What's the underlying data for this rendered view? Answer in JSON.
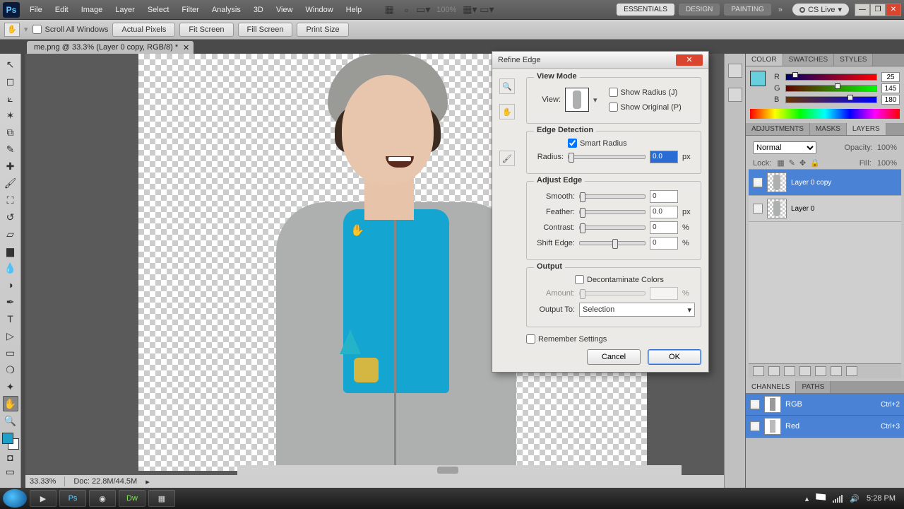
{
  "menu": {
    "items": [
      "File",
      "Edit",
      "Image",
      "Layer",
      "Select",
      "Filter",
      "Analysis",
      "3D",
      "View",
      "Window",
      "Help"
    ]
  },
  "workspace": {
    "essentials": "ESSENTIALS",
    "design": "DESIGN",
    "painting": "PAINTING",
    "cslive": "CS Live",
    "zoom": "100%"
  },
  "options": {
    "scroll_all": "Scroll All Windows",
    "actual": "Actual Pixels",
    "fit": "Fit Screen",
    "fill": "Fill Screen",
    "print": "Print Size"
  },
  "doc": {
    "tab": "me.png @ 33.3% (Layer 0 copy, RGB/8) *",
    "zoom": "33.33%",
    "docsize": "Doc: 22.8M/44.5M"
  },
  "color": {
    "tabs": {
      "color": "COLOR",
      "swatches": "SWATCHES",
      "styles": "STYLES"
    },
    "r": "25",
    "g": "145",
    "b": "180",
    "rlab": "R",
    "glab": "G",
    "blab": "B"
  },
  "rightTabs": {
    "adjustments": "ADJUSTMENTS",
    "masks": "MASKS",
    "layers": "LAYERS"
  },
  "layers": {
    "blend": "Normal",
    "opacity_label": "Opacity:",
    "opacity": "100%",
    "lock": "Lock:",
    "fill_label": "Fill:",
    "fill": "100%",
    "items": [
      {
        "name": "Layer 0 copy"
      },
      {
        "name": "Layer 0"
      }
    ]
  },
  "channels": {
    "tabs": {
      "channels": "CHANNELS",
      "paths": "PATHS"
    },
    "items": [
      {
        "name": "RGB",
        "sc": "Ctrl+2"
      },
      {
        "name": "Red",
        "sc": "Ctrl+3"
      }
    ]
  },
  "dialog": {
    "title": "Refine Edge",
    "view_mode": "View Mode",
    "view": "View:",
    "show_radius": "Show Radius (J)",
    "show_original": "Show Original (P)",
    "edge_detection": "Edge Detection",
    "smart_radius": "Smart Radius",
    "radius": "Radius:",
    "radius_val": "0.0",
    "radius_unit": "px",
    "adjust_edge": "Adjust Edge",
    "smooth": "Smooth:",
    "smooth_val": "0",
    "feather": "Feather:",
    "feather_val": "0.0",
    "feather_unit": "px",
    "contrast": "Contrast:",
    "contrast_val": "0",
    "contrast_unit": "%",
    "shift": "Shift Edge:",
    "shift_val": "0",
    "shift_unit": "%",
    "output": "Output",
    "decon": "Decontaminate Colors",
    "amount": "Amount:",
    "amount_unit": "%",
    "output_to": "Output To:",
    "output_sel": "Selection",
    "remember": "Remember Settings",
    "cancel": "Cancel",
    "ok": "OK"
  },
  "taskbar": {
    "time": "5:28 PM"
  }
}
